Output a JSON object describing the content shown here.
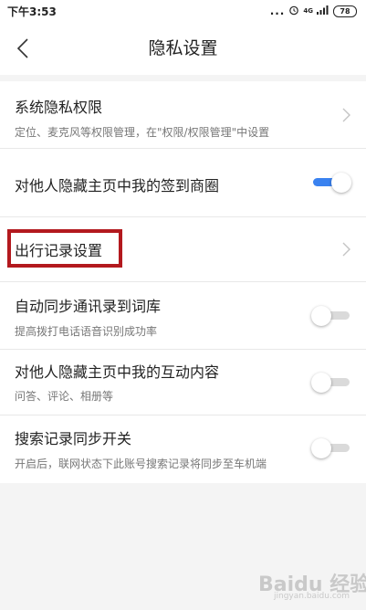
{
  "status_bar": {
    "time": "下午3:53",
    "dots": "...",
    "network": "4G",
    "battery": "78"
  },
  "nav": {
    "title": "隐私设置"
  },
  "settings": {
    "system_privacy": {
      "title": "系统隐私权限",
      "subtitle": "定位、麦克风等权限管理，在\"权限/权限管理\"中设置"
    },
    "hide_checkin": {
      "title": "对他人隐藏主页中我的签到商圈",
      "enabled": true
    },
    "travel_record": {
      "title": "出行记录设置"
    },
    "sync_contacts": {
      "title": "自动同步通讯录到词库",
      "subtitle": "提高拨打电话语音识别成功率",
      "enabled": false
    },
    "hide_interaction": {
      "title": "对他人隐藏主页中我的互动内容",
      "subtitle": "问答、评论、相册等",
      "enabled": false
    },
    "search_sync": {
      "title": "搜索记录同步开关",
      "subtitle": "开启后，联网状态下此账号搜索记录将同步至车机端",
      "enabled": false
    }
  },
  "watermark": {
    "text": "Baidu 经验",
    "sub": "jingyan.baidu.com"
  },
  "colors": {
    "accent": "#3a82f0",
    "highlight": "#b3191e",
    "background": "#f4f4f4"
  }
}
